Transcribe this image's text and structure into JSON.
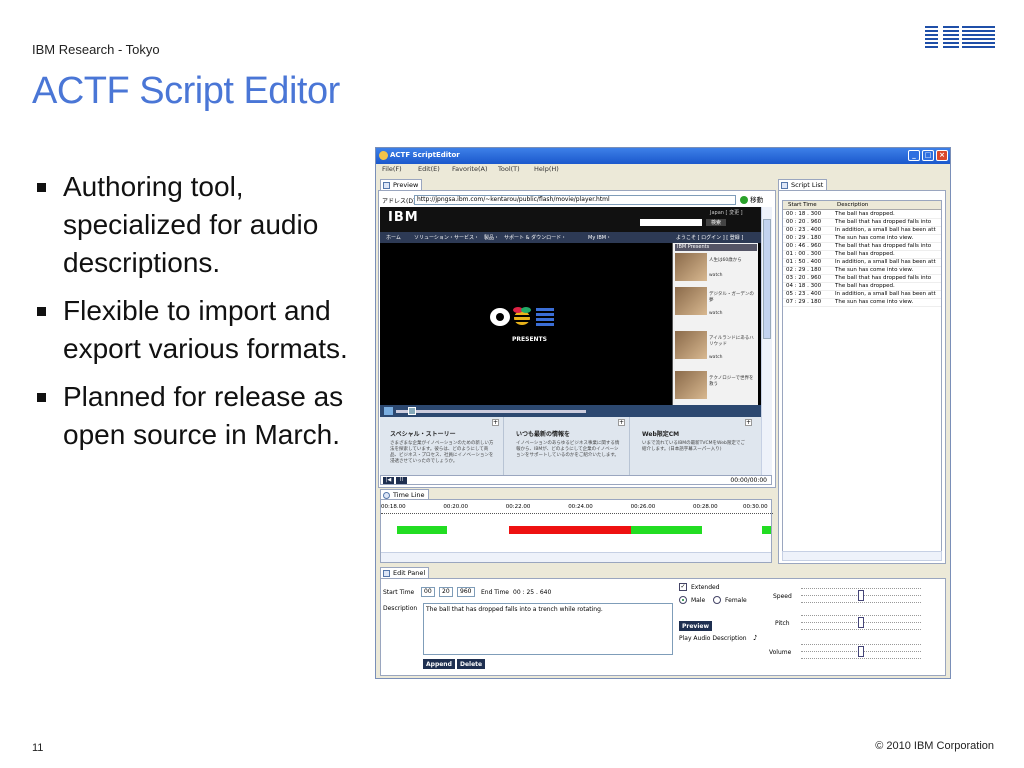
{
  "slide": {
    "org": "IBM Research - Tokyo",
    "logo": "IBM",
    "title": "ACTF Script Editor",
    "bullets": [
      "Authoring tool, specialized for audio descriptions.",
      "Flexible to import and export various formats.",
      "Planned for release as open source in March."
    ],
    "page_number": "11",
    "copyright": "© 2010 IBM Corporation"
  },
  "app": {
    "window_title": "ACTF ScriptEditor",
    "menu": [
      "File(F)",
      "Edit(E)",
      "Favorite(A)",
      "Tool(T)",
      "Help(H)"
    ],
    "preview": {
      "tab_label": "Preview",
      "address_label": "アドレス(D)",
      "address_url": "http://jpngsa.ibm.com/~kentarou/public/flash/movie/player.html",
      "go_label": "移動",
      "site": {
        "logo": "IBM",
        "country": "Japan [ 変更 ]",
        "search_button": "検索",
        "nav": [
          "ホーム",
          "ソリューション・",
          "サービス・",
          "製品・",
          "サポート & ダウンロード・",
          "My IBM・"
        ],
        "welcome": "ようこそ [ ログイン ] [ 登録 ]",
        "sidebar_title": "IBM Presents",
        "sidebar_items": [
          {
            "caption": "人生は60歳から",
            "watch": "watch"
          },
          {
            "caption": "デジタル・ガーデンの夢",
            "watch": "watch"
          },
          {
            "caption": "アイルランドにあるハリウッド",
            "watch": "watch"
          },
          {
            "caption": "テクノロジーで世界を救う",
            "watch": ""
          }
        ],
        "video_text": "PRESENTS",
        "sections": [
          {
            "heading": "スペシャル・ストーリー",
            "text": "さまざまな企業がイノベーションのための新しい方法を探索しています。彼らは、どのようにして商品、ビジネス・プロセス、社員にイノベーションを浸透させていったのでしょうか。"
          },
          {
            "heading": "いつも最新の情報を",
            "text": "イノベーションのあらゆるビジネス事業に関する情報から、IBMが、どのようにして企業のイノベーションをサポートしているのかをご紹介いたします。"
          },
          {
            "heading": "Web限定CM",
            "text": "いまで流れているIBMの最新TVCMをWeb限定でご紹介します。(日本語字幕スーパー入り)"
          }
        ]
      },
      "player_time": "00:00/00:00"
    },
    "timeline": {
      "tab_label": "Time Line",
      "ticks": [
        "00:18.00",
        "00:20.00",
        "00:22.00",
        "00:24.00",
        "00:26.00",
        "00:28.00",
        "00:30.00"
      ],
      "segments": [
        {
          "color": "#22dd22",
          "start": 18.5,
          "end": 20.1
        },
        {
          "color": "#ee1111",
          "start": 22.1,
          "end": 26.0
        },
        {
          "color": "#22dd22",
          "start": 26.0,
          "end": 28.3
        },
        {
          "color": "#22dd22",
          "start": 30.2,
          "end": 31.6
        }
      ]
    },
    "script_list": {
      "tab_label": "Script List",
      "columns": [
        "Start Time",
        "Description"
      ],
      "rows": [
        {
          "time": "00 : 18 . 300",
          "desc": "The ball has dropped."
        },
        {
          "time": "00 : 20 . 960",
          "desc": "The ball that has dropped falls into"
        },
        {
          "time": "00 : 23 . 400",
          "desc": "In addition, a small ball has been att"
        },
        {
          "time": "00 : 29 . 180",
          "desc": "The sun has come into view."
        },
        {
          "time": "00 : 46 . 960",
          "desc": "The ball that has dropped falls into"
        },
        {
          "time": "01 : 00 . 300",
          "desc": "The ball has dropped."
        },
        {
          "time": "01 : 50 . 400",
          "desc": "In addition, a small ball has been att"
        },
        {
          "time": "02 : 29 . 180",
          "desc": "The sun has come into view."
        },
        {
          "time": "03 : 20 . 960",
          "desc": "The ball that has dropped falls into"
        },
        {
          "time": "04 : 18 . 300",
          "desc": "The ball has dropped."
        },
        {
          "time": "05 : 23 . 400",
          "desc": "In addition, a small ball has been att"
        },
        {
          "time": "07 : 29 . 180",
          "desc": "The sun has come into view."
        }
      ]
    },
    "edit_panel": {
      "tab_label": "Edit Panel",
      "start_time_label": "Start Time",
      "start_min": "00",
      "start_sec": "20",
      "start_ms": "960",
      "end_time_label": "End Time",
      "end_time_value": "00 : 25 . 640",
      "description_label": "Description",
      "description_value": "The ball that has dropped falls into a trench while rotating.",
      "append_label": "Append",
      "delete_label": "Delete",
      "extended_label": "Extended",
      "extended_checked": true,
      "male_label": "Male",
      "female_label": "Female",
      "gender_selected": "Male",
      "preview_label": "Preview",
      "play_audio_label": "Play Audio Description",
      "speed_label": "Speed",
      "pitch_label": "Pitch",
      "volume_label": "Volume",
      "speed_level": 0.5,
      "pitch_level": 0.5,
      "volume_level": 0.5
    }
  }
}
